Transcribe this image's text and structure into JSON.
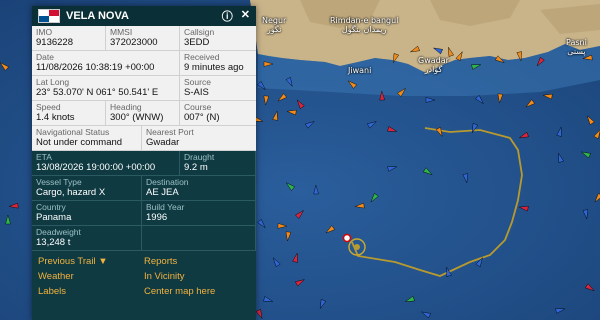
{
  "vessel": {
    "name": "VELA NOVA",
    "flag_colors": [
      "#ffffff",
      "#d21034",
      "#005293"
    ],
    "imo_label": "IMO",
    "imo": "9136228",
    "mmsi_label": "MMSI",
    "mmsi": "372023000",
    "callsign_label": "Callsign",
    "callsign": "3EDD",
    "date_label": "Date",
    "date": "11/08/2026 10:38:19 +00:00",
    "received_label": "Received",
    "received": "9 minutes ago",
    "latlong_label": "Lat Long",
    "latlong": "23° 53.070' N 061° 50.541' E",
    "source_label": "Source",
    "source": "S-AIS",
    "speed_label": "Speed",
    "speed": "1.4 knots",
    "heading_label": "Heading",
    "heading": "300° (WNW)",
    "course_label": "Course",
    "course": "007° (N)",
    "navstatus_label": "Navigational Status",
    "navstatus": "Not under command",
    "nearestport_label": "Nearest Port",
    "nearestport": "Gwadar",
    "eta_label": "ETA",
    "eta": "13/08/2026 19:00:00 +00:00",
    "draught_label": "Draught",
    "draught": "9.2 m",
    "type_label": "Vessel Type",
    "type": "Cargo, hazard X",
    "destination_label": "Destination",
    "destination": "AE JEA",
    "country_label": "Country",
    "country": "Panama",
    "buildyear_label": "Build Year",
    "buildyear": "1996",
    "deadweight_label": "Deadweight",
    "deadweight": "13,248 t"
  },
  "header_buttons": {
    "info_icon": "info-icon",
    "close_icon": "close-icon"
  },
  "links": {
    "previous_trail": "Previous Trail",
    "weather": "Weather",
    "labels": "Labels",
    "reports": "Reports",
    "in_vicinity": "In Vicinity",
    "center_map": "Center map here"
  },
  "map_places": {
    "negur": "Negur",
    "negur_local": "نگور",
    "rimdan": "Rimdan-e bangul",
    "rimdan_local": "ریمدان بنگول",
    "jiwani": "Jiwani",
    "gwadar": "Gwadar",
    "gwadar_local": "گوادر",
    "pasni": "Pasni",
    "pasni_local": "پسنی"
  },
  "colors": {
    "sea": "#1f4e86",
    "land": "#c9b48a",
    "trail": "#b89a2e",
    "panel_dark": "#0f3a42",
    "link": "#f2b23e"
  }
}
